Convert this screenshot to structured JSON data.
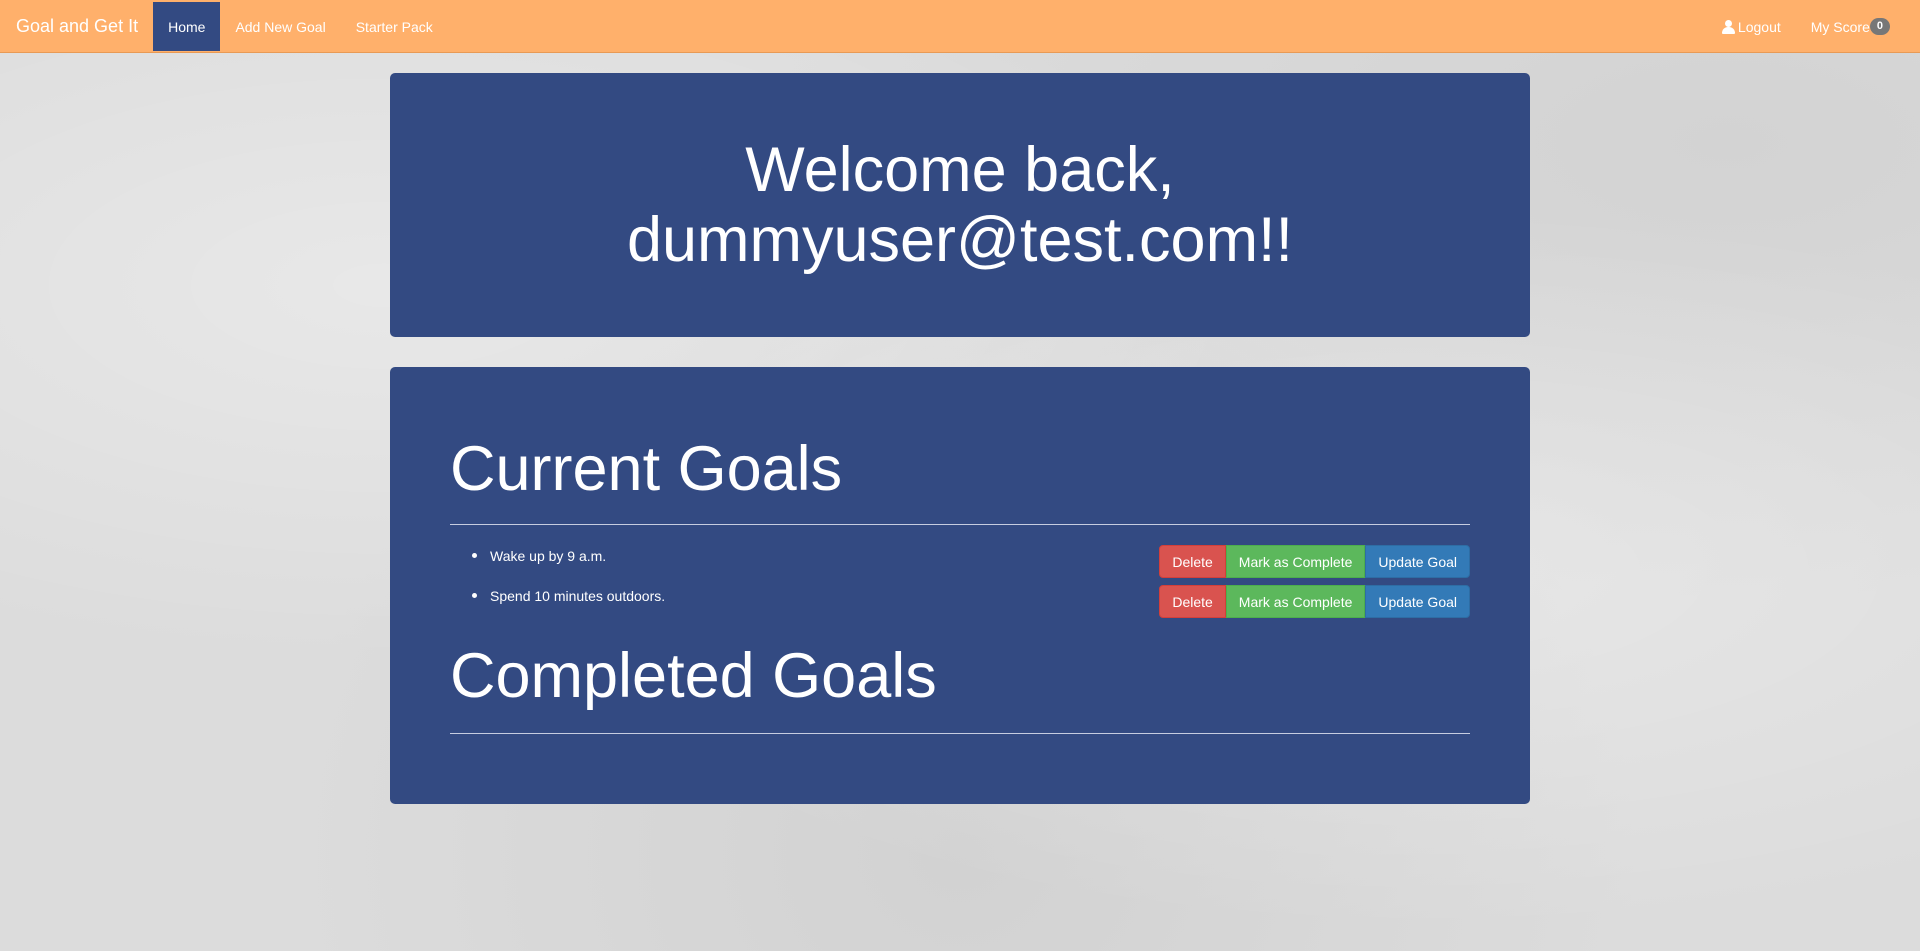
{
  "navbar": {
    "brand": "Goal and Get It",
    "links": [
      {
        "label": "Home",
        "active": true
      },
      {
        "label": "Add New Goal",
        "active": false
      },
      {
        "label": "Starter Pack",
        "active": false
      }
    ],
    "logout_label": "Logout",
    "score_label": "My Score",
    "score_value": "0",
    "background_color": "#ffb06b",
    "active_color": "#334a82"
  },
  "welcome": {
    "line1": "Welcome back,",
    "line2": "dummyuser@test.com!!"
  },
  "current_goals": {
    "title": "Current Goals",
    "items": [
      {
        "text": "Wake up by 9 a.m."
      },
      {
        "text": "Spend 10 minutes outdoors."
      }
    ],
    "buttons": {
      "delete": "Delete",
      "complete": "Mark as Complete",
      "update": "Update Goal"
    }
  },
  "completed_goals": {
    "title": "Completed Goals",
    "items": []
  }
}
